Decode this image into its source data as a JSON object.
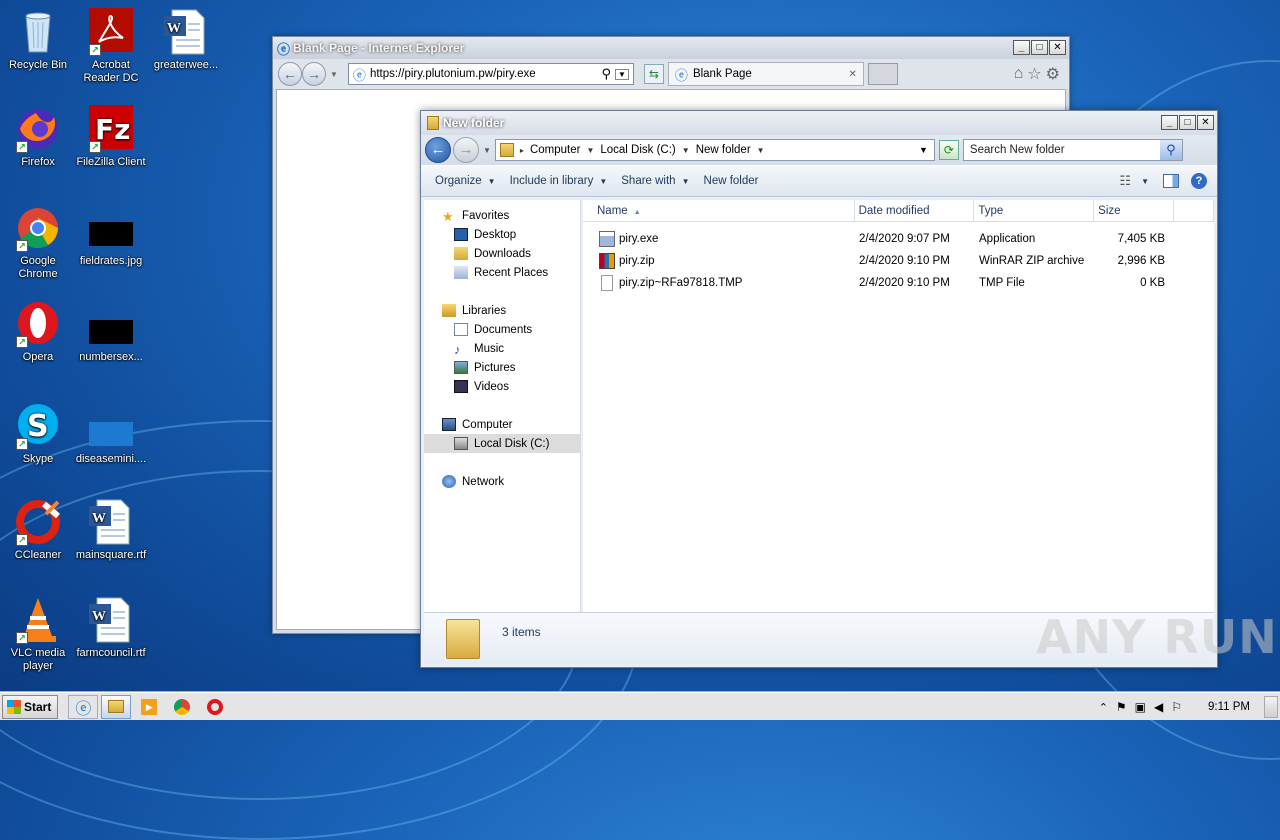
{
  "desktop": {
    "icons": [
      {
        "label": "Recycle Bin"
      },
      {
        "label": "Acrobat Reader DC"
      },
      {
        "label": "greaterwee..."
      },
      {
        "label": "Firefox"
      },
      {
        "label": "FileZilla Client"
      },
      {
        "label": "Google Chrome"
      },
      {
        "label": "fieldrates.jpg"
      },
      {
        "label": "Opera"
      },
      {
        "label": "numbersex..."
      },
      {
        "label": "Skype"
      },
      {
        "label": "diseasemini...."
      },
      {
        "label": "CCleaner"
      },
      {
        "label": "mainsquare.rtf"
      },
      {
        "label": "VLC media player"
      },
      {
        "label": "farmcouncil.rtf"
      }
    ]
  },
  "ie": {
    "title": "Blank Page - Internet Explorer",
    "address": "https://piry.plutonium.pw/piry.exe",
    "tab_label": "Blank Page",
    "tab_close": "✕"
  },
  "explorer": {
    "title": "New folder",
    "breadcrumb": [
      "Computer",
      "Local Disk (C:)",
      "New folder"
    ],
    "search_placeholder": "Search New folder",
    "toolbar": {
      "organize": "Organize",
      "include": "Include in library",
      "share": "Share with",
      "new_folder": "New folder"
    },
    "nav": {
      "favorites": "Favorites",
      "desktop": "Desktop",
      "downloads": "Downloads",
      "recent": "Recent Places",
      "libraries": "Libraries",
      "documents": "Documents",
      "music": "Music",
      "pictures": "Pictures",
      "videos": "Videos",
      "computer": "Computer",
      "local_disk": "Local Disk (C:)",
      "network": "Network"
    },
    "columns": {
      "name": "Name",
      "date": "Date modified",
      "type": "Type",
      "size": "Size"
    },
    "files": [
      {
        "name": "piry.exe",
        "date": "2/4/2020 9:07 PM",
        "type": "Application",
        "size": "7,405 KB"
      },
      {
        "name": "piry.zip",
        "date": "2/4/2020 9:10 PM",
        "type": "WinRAR ZIP archive",
        "size": "2,996 KB"
      },
      {
        "name": "piry.zip~RFa97818.TMP",
        "date": "2/4/2020 9:10 PM",
        "type": "TMP File",
        "size": "0 KB"
      }
    ],
    "status": "3 items"
  },
  "taskbar": {
    "start": "Start",
    "clock": "9:11 PM"
  },
  "watermark": "ANY RUN"
}
